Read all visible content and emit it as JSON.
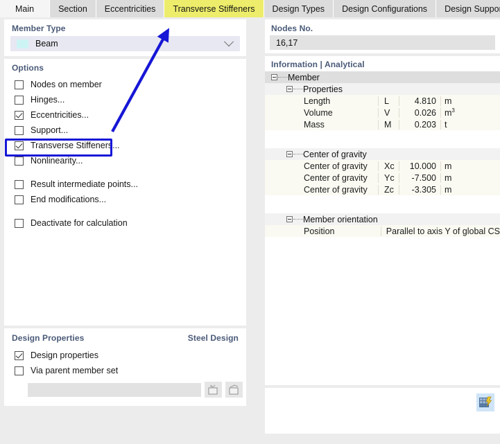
{
  "tabs": [
    {
      "label": "Main",
      "active": false
    },
    {
      "label": "Section",
      "active": false
    },
    {
      "label": "Eccentricities",
      "active": false
    },
    {
      "label": "Transverse Stiffeners",
      "active": true
    },
    {
      "label": "Design Types",
      "active": false
    },
    {
      "label": "Design Configurations",
      "active": false
    },
    {
      "label": "Design Supports & Deflection",
      "active": false
    }
  ],
  "member_type": {
    "group_label": "Member Type",
    "value": "Beam",
    "swatch_color": "#cdf4f4",
    "chevron_icon": "chevron-down-icon"
  },
  "options": {
    "group_label": "Options",
    "items": [
      {
        "label": "Nodes on member",
        "checked": false,
        "gap": false
      },
      {
        "label": "Hinges...",
        "checked": false,
        "gap": false
      },
      {
        "label": "Eccentricities...",
        "checked": true,
        "gap": false
      },
      {
        "label": "Support...",
        "checked": false,
        "gap": false
      },
      {
        "label": "Transverse Stiffeners...",
        "checked": true,
        "gap": false
      },
      {
        "label": "Nonlinearity...",
        "checked": false,
        "gap": false
      },
      {
        "label": "Result intermediate points...",
        "checked": false,
        "gap": true
      },
      {
        "label": "End modifications...",
        "checked": false,
        "gap": false
      },
      {
        "label": "Deactivate for calculation",
        "checked": false,
        "gap": true
      }
    ]
  },
  "design_properties": {
    "group_label": "Design Properties",
    "group_label_right": "Steel Design",
    "items": [
      {
        "label": "Design properties",
        "checked": true
      },
      {
        "label": "Via parent member set",
        "checked": false
      }
    ],
    "input_value": "",
    "buttons": [
      {
        "icon": "new-member-set-icon"
      },
      {
        "icon": "edit-member-set-icon"
      }
    ]
  },
  "nodes": {
    "group_label": "Nodes No.",
    "value": "16,17"
  },
  "information": {
    "group_label": "Information | Analytical",
    "root": "Member",
    "groups": [
      {
        "title": "Properties",
        "rows": [
          {
            "name": "Length",
            "symbol": "L",
            "value": "4.810",
            "unit": "m",
            "unit_sup": ""
          },
          {
            "name": "Volume",
            "symbol": "V",
            "value": "0.026",
            "unit": "m",
            "unit_sup": "3"
          },
          {
            "name": "Mass",
            "symbol": "M",
            "value": "0.203",
            "unit": "t",
            "unit_sup": ""
          }
        ]
      },
      {
        "title": "Center of gravity",
        "rows": [
          {
            "name": "Center of gravity",
            "symbol": "Xc",
            "value": "10.000",
            "unit": "m",
            "unit_sup": ""
          },
          {
            "name": "Center of gravity",
            "symbol": "Yc",
            "value": "-7.500",
            "unit": "m",
            "unit_sup": ""
          },
          {
            "name": "Center of gravity",
            "symbol": "Zc",
            "value": "-3.305",
            "unit": "m",
            "unit_sup": ""
          }
        ]
      },
      {
        "title": "Member orientation",
        "rows": [
          {
            "name": "Position",
            "symbol": "",
            "value": "",
            "unit": "",
            "unit_sup": "",
            "wide_text": "Parallel to axis Y of global CS"
          }
        ]
      }
    ]
  },
  "bottom_right": {
    "icon": "table-with-lightning-icon"
  },
  "annotations": {
    "highlight_color": "#1717d6",
    "arrow_color": "#1717d6",
    "highlight_target": "Transverse Stiffeners...",
    "arrow_target": "Transverse Stiffeners tab"
  }
}
